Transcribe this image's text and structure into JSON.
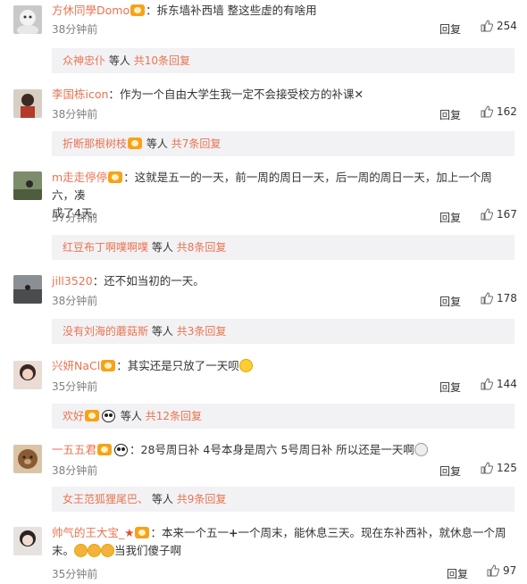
{
  "reply_label": "回复",
  "comments": [
    {
      "username": "方休同學Domo",
      "sep": "：",
      "text": "拆东墙补西墙 整这些虚的有啥用",
      "time": "38分钟前",
      "likes": "254",
      "sub": {
        "who": "众神忠仆",
        "mid": "等人",
        "total": "共10条回复"
      }
    },
    {
      "username": "李国栋icon",
      "sep": "：",
      "text": "作为一个自由大学生我一定不会接受校方的补课",
      "time": "38分钟前",
      "likes": "162",
      "sub": {
        "who": "折断那根树枝",
        "mid": "等人",
        "total": "共7条回复"
      }
    },
    {
      "username": "m走走停停",
      "sep": "：",
      "text": "这就是五一的一天，前一周的周日一天，后一周的周日一天，加上一个周六，凑",
      "text2": "成了4天。",
      "time": "37分钟前",
      "likes": "167",
      "sub": {
        "who": "红豆布丁啊噗啊噗",
        "mid": "等人",
        "total": "共8条回复"
      }
    },
    {
      "username": "jill3520",
      "sep": "：",
      "text": "还不如当初的一天。",
      "time": "38分钟前",
      "likes": "178",
      "sub": {
        "who": "没有刘海的蘑菇斯",
        "mid": "等人",
        "total": "共3条回复"
      }
    },
    {
      "username": "兴妍NaCl",
      "sep": "：",
      "text": "其实还是只放了一天呗",
      "time": "35分钟前",
      "likes": "144",
      "sub": {
        "who": "欢好",
        "mid": "等人",
        "total": "共12条回复"
      }
    },
    {
      "username": "一五五君",
      "sep": "：",
      "text": "28号周日补 4号本身是周六 5号周日补 所以还是一天啊",
      "time": "38分钟前",
      "likes": "125",
      "sub": {
        "who": "女王范狐狸尾巴、",
        "mid": "等人",
        "total": "共9条回复"
      }
    },
    {
      "username": "帅气的王大宝_",
      "sep": "：",
      "text_a": "本来一个五一",
      "text_b": "一个周末，能休息三天。现在东补西补，就休息一个周",
      "text2_a": "末。",
      "text2_b": "当我们傻子啊",
      "time": "35分钟前",
      "likes": "97"
    }
  ]
}
